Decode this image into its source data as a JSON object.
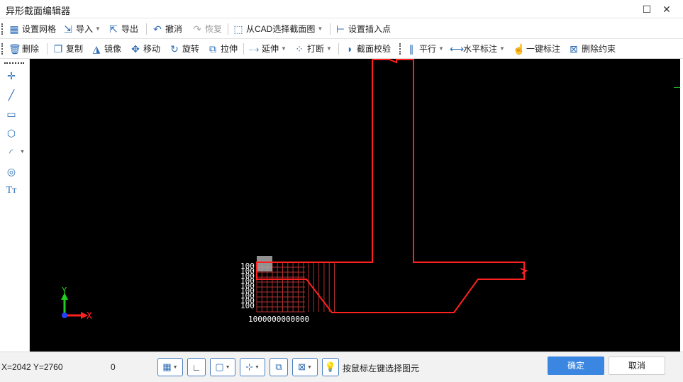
{
  "window": {
    "title": "异形截面编辑器",
    "maximize_glyph": "☐",
    "close_glyph": "✕"
  },
  "toolbar1": {
    "grid_label": "设置网格",
    "import_label": "导入",
    "export_label": "导出",
    "undo_label": "撤消",
    "redo_label": "恢复",
    "cad_label": "从CAD选择截面图",
    "insert_point_label": "设置插入点"
  },
  "toolbar2": {
    "delete_label": "删除",
    "copy_label": "复制",
    "mirror_label": "镜像",
    "move_label": "移动",
    "rotate_label": "旋转",
    "stretch_label": "拉伸",
    "extend_label": "延伸",
    "break_label": "打断",
    "check_label": "截面校验",
    "parallel_label": "平行",
    "horizontal_dim_label": "水平标注",
    "auto_dim_label": "一键标注",
    "delete_constraint_label": "删除约束"
  },
  "left_tools": [
    "point-icon",
    "line-icon",
    "rectangle-icon",
    "polygon-icon",
    "arc-icon",
    "circle-icon",
    "text-icon"
  ],
  "canvas": {
    "axis_x_label": "X",
    "axis_y_label": "Y",
    "grid_y_labels": [
      "100",
      "100",
      "100",
      "100",
      "100",
      "100",
      "100",
      "100",
      "100"
    ],
    "grid_x_labels": "1000000000000",
    "colors": {
      "background": "#000000",
      "section": "#ff2020",
      "grid": "#b03030",
      "axis_y": "#22cc22",
      "axis_x": "#ff2020",
      "origin": "#2040ff"
    }
  },
  "status": {
    "coords": "X=2042 Y=2760",
    "count": "0",
    "hint": "按鼠标左键选择图元",
    "ok_label": "确定",
    "cancel_label": "取消"
  },
  "colors": {
    "accent": "#2d6db5",
    "primary_button": "#3b86e0"
  }
}
